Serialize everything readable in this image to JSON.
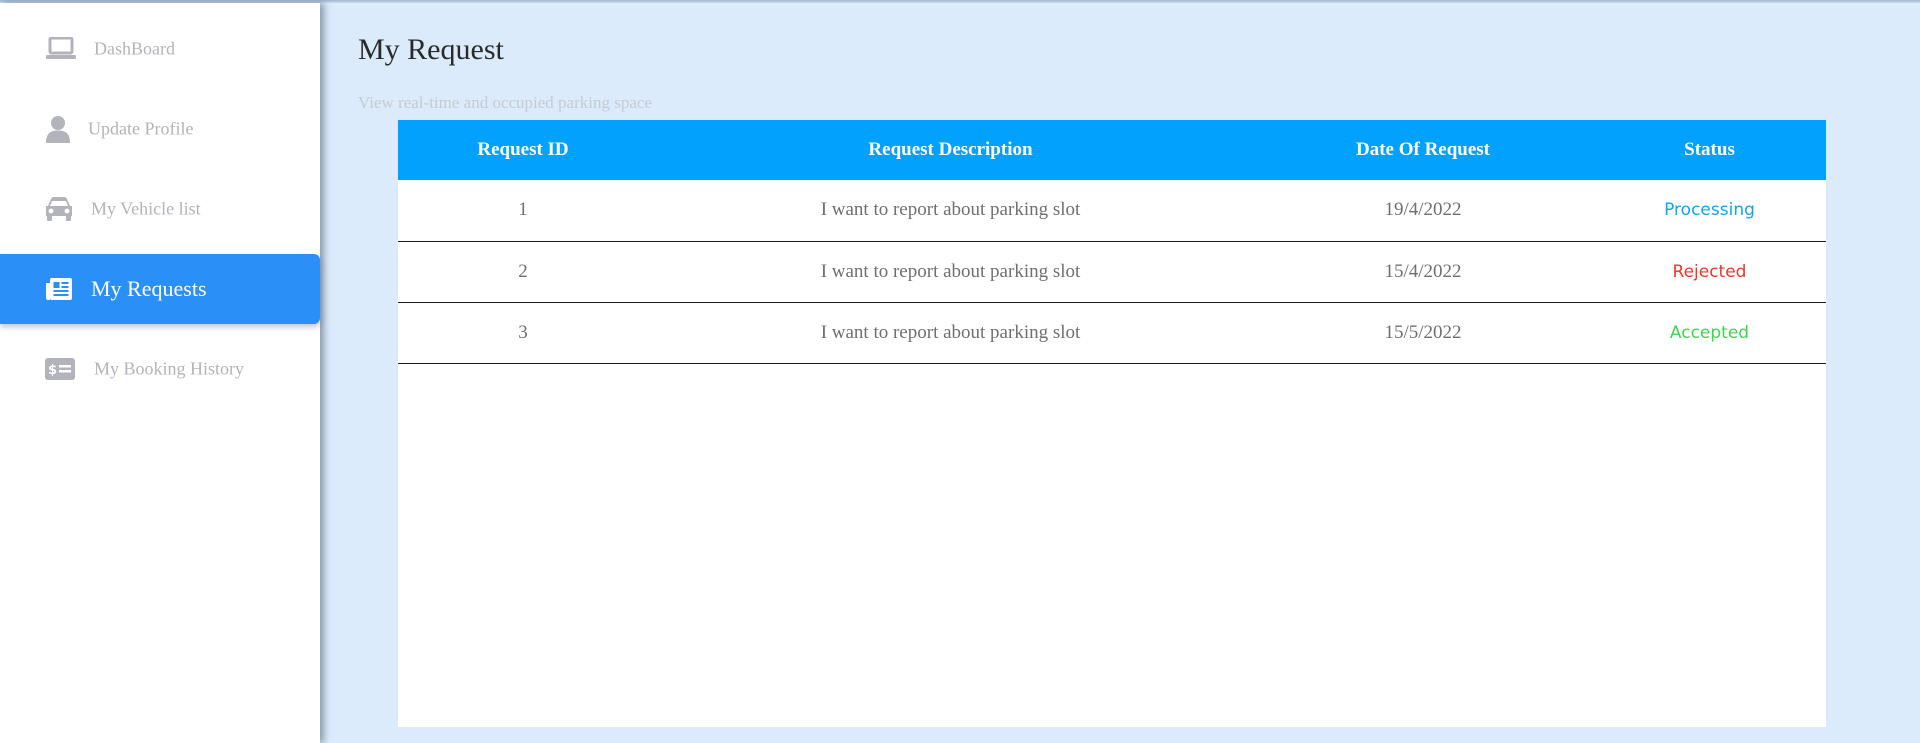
{
  "sidebar": {
    "items": [
      {
        "label": "DashBoard",
        "icon": "laptop-icon",
        "active": false
      },
      {
        "label": "Update Profile",
        "icon": "user-icon",
        "active": false
      },
      {
        "label": "My Vehicle list",
        "icon": "car-icon",
        "active": false
      },
      {
        "label": "My Requests",
        "icon": "newspaper-icon",
        "active": true
      },
      {
        "label": "My Booking History",
        "icon": "money-check-icon",
        "active": false
      }
    ]
  },
  "main": {
    "title": "My Request",
    "subtitle": "View real-time and occupied parking space"
  },
  "table": {
    "headers": [
      "Request ID",
      "Request Description",
      "Date Of Request",
      "Status"
    ],
    "rows": [
      {
        "id": "1",
        "description": "I want to report about parking slot",
        "date": "19/4/2022",
        "status": "Processing",
        "status_color": "#11a6e6"
      },
      {
        "id": "2",
        "description": "I want to report about parking slot",
        "date": "15/4/2022",
        "status": "Rejected",
        "status_color": "#e8392b"
      },
      {
        "id": "3",
        "description": "I want to report about parking slot",
        "date": "15/5/2022",
        "status": "Accepted",
        "status_color": "#3fd64e"
      }
    ]
  },
  "colors": {
    "background": "#dcebfb",
    "accent": "#2a8ff7",
    "table_header": "#02a1fd",
    "muted_text": "#b3b3bb"
  }
}
